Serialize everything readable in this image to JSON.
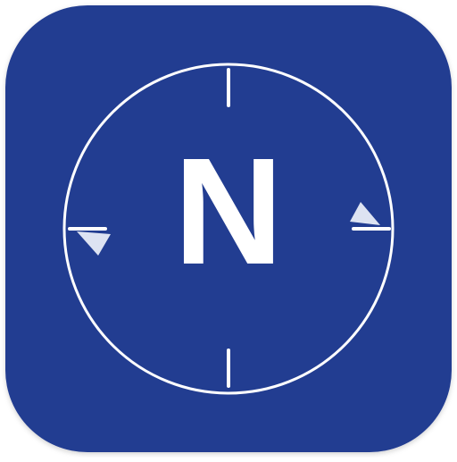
{
  "app_icon": {
    "name": "compass-app-icon",
    "letter": "N",
    "colors": {
      "background": "#233C91",
      "foreground": "#FFFFFF",
      "marker": "#DDE3F2"
    }
  }
}
